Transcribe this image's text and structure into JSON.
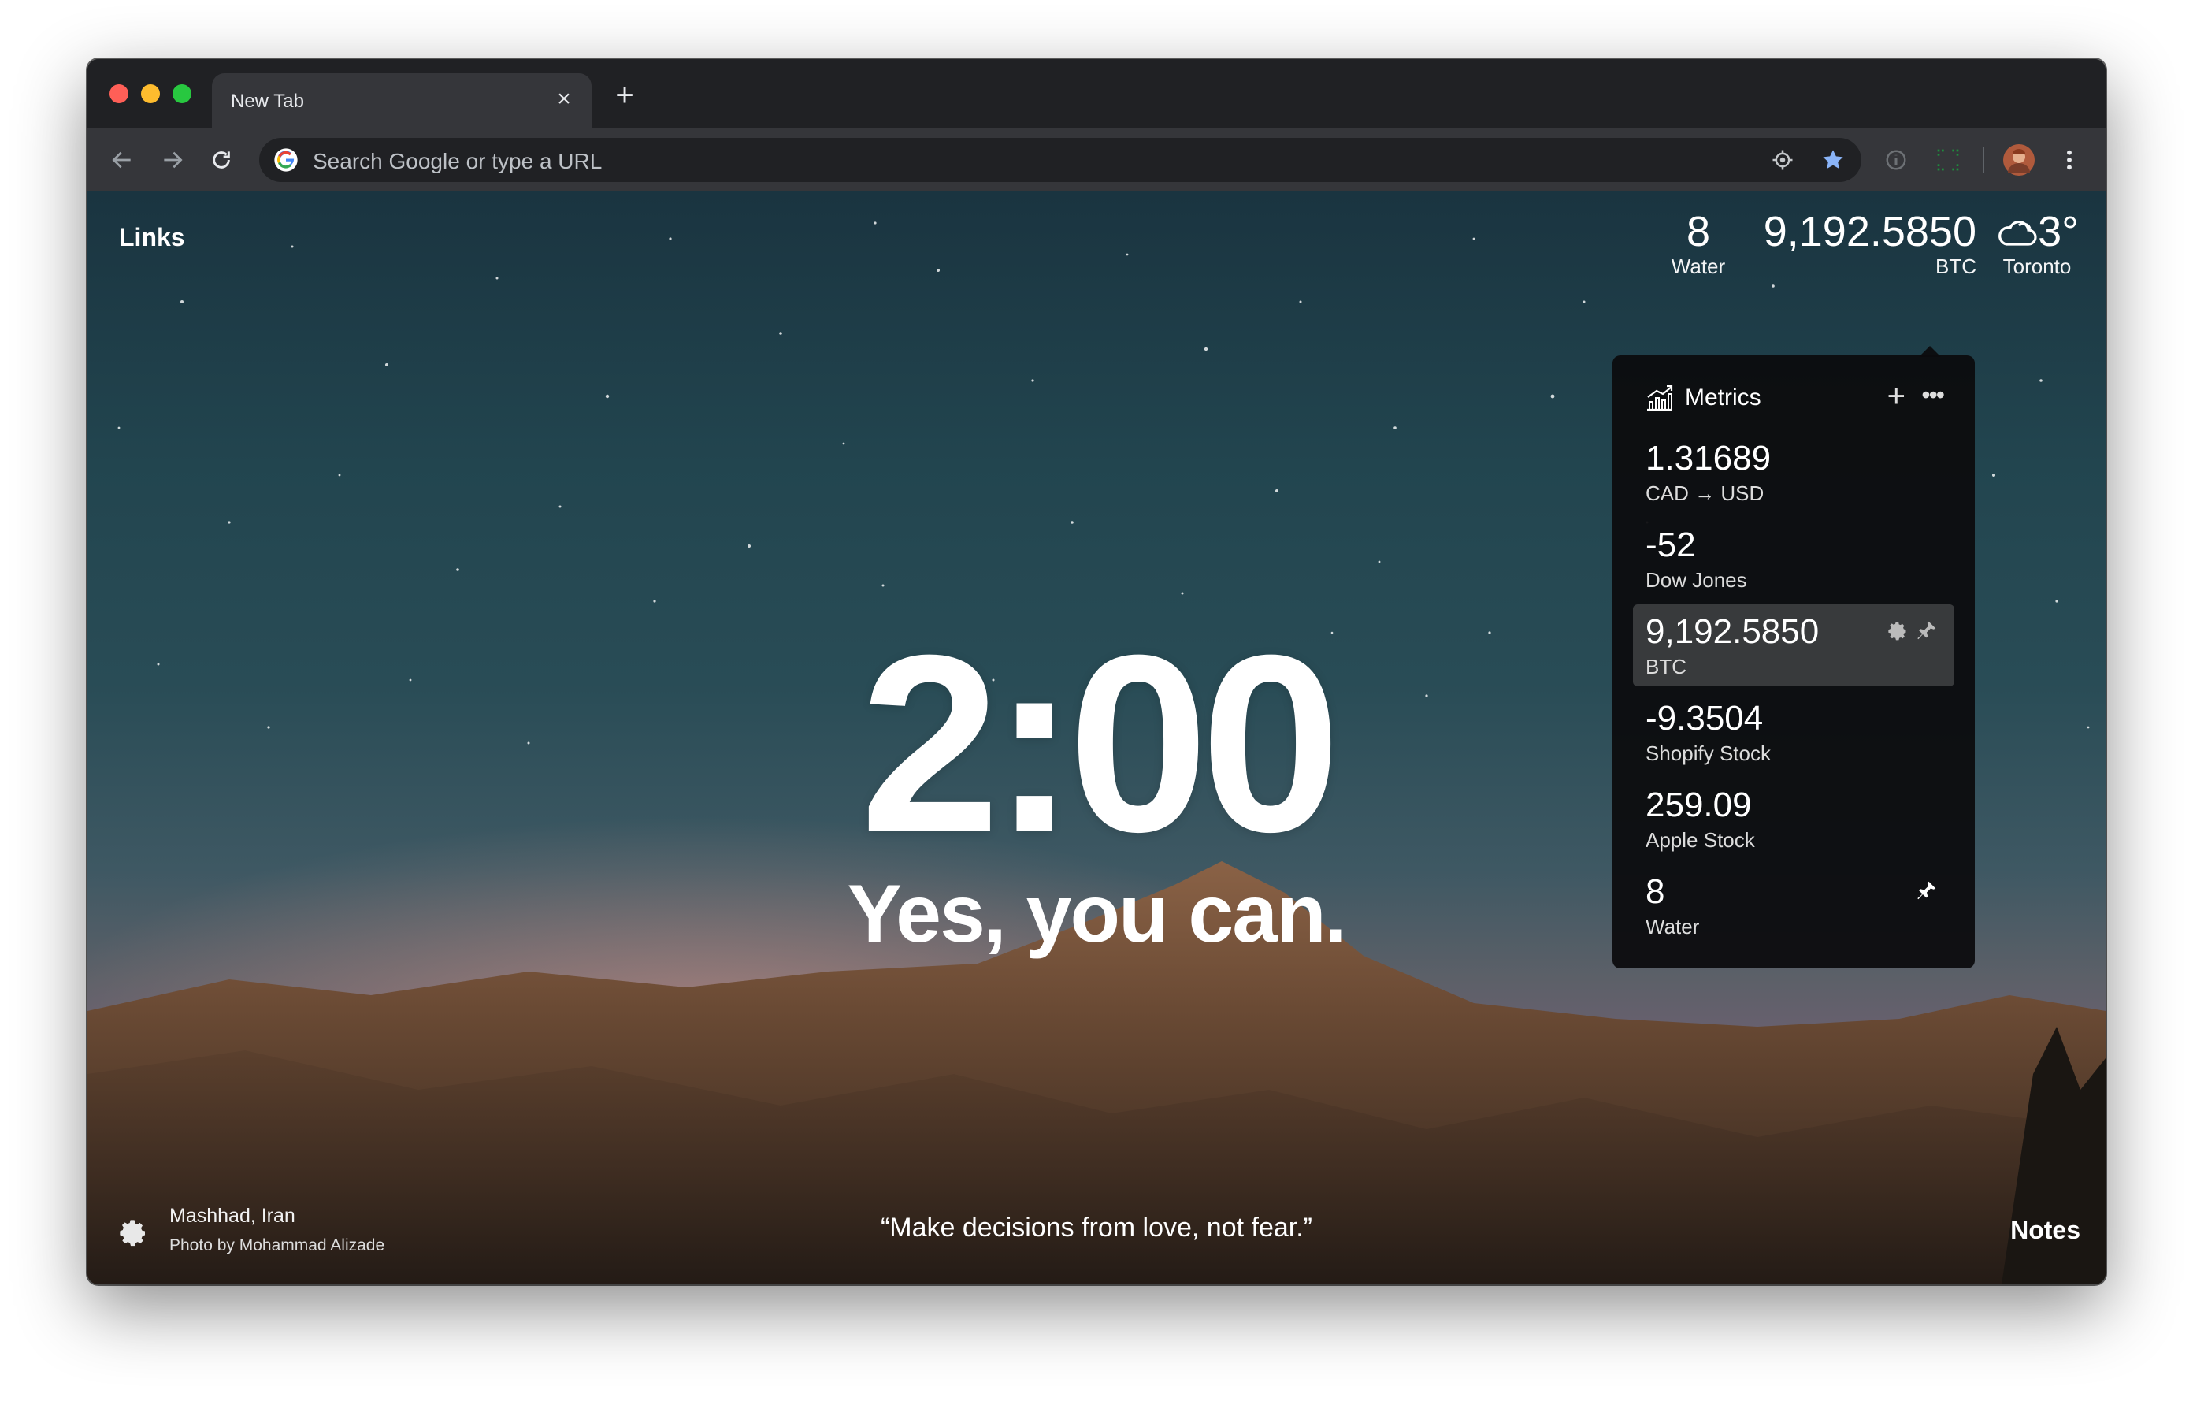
{
  "browser": {
    "tab_title": "New Tab",
    "tab_close": "×",
    "new_tab": "+",
    "omnibox_placeholder": "Search Google or type a URL"
  },
  "dashboard": {
    "links_label": "Links",
    "water_value": "8",
    "water_label": "Water",
    "btc_value": "9,192.5850",
    "btc_label": "BTC",
    "weather_temp": "3°",
    "weather_city": "Toronto",
    "clock_time": "2:00",
    "mantra": "Yes, you can.",
    "quote": "“Make decisions from love, not fear.”",
    "location_name": "Mashhad, Iran",
    "photo_credit": "Photo by Mohammad Alizade",
    "notes_label": "Notes"
  },
  "metrics": {
    "title": "Metrics",
    "add": "+",
    "more": "•••",
    "items": [
      {
        "value": "1.31689",
        "label": "CAD → USD"
      },
      {
        "value": "-52",
        "label": "Dow Jones"
      },
      {
        "value": "9,192.5850",
        "label": "BTC"
      },
      {
        "value": "-9.3504",
        "label": "Shopify Stock"
      },
      {
        "value": "259.09",
        "label": "Apple Stock"
      },
      {
        "value": "8",
        "label": "Water"
      }
    ]
  },
  "colors": {
    "traffic_red": "#ff5f57",
    "traffic_yellow": "#febc2e",
    "traffic_green": "#28c840",
    "bookmark_star": "#8ab4f8",
    "chrome_dark": "#202124"
  }
}
